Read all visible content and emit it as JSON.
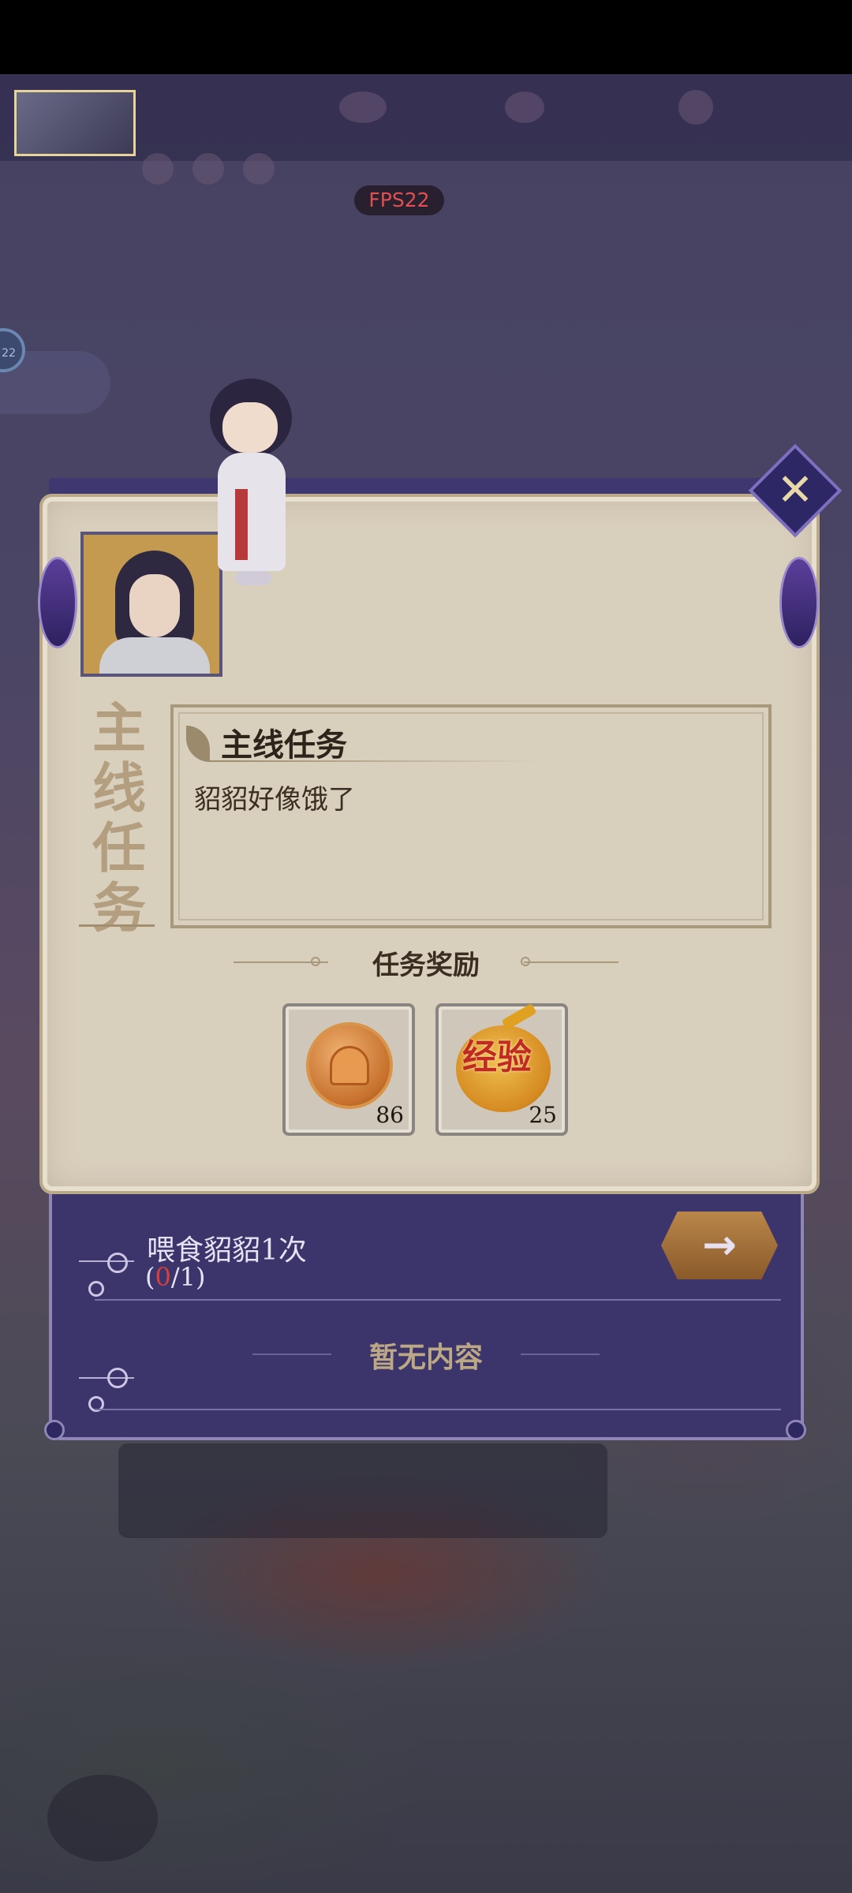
{
  "hud": {
    "fps_label": "FPS22",
    "side_badge": "22"
  },
  "dialog": {
    "vertical_title": [
      "主",
      "线",
      "任",
      "务"
    ],
    "task_title": "主线任务",
    "task_description": "貂貂好像饿了",
    "reward_section_title": "任务奖励",
    "rewards": [
      {
        "icon": "coin-icon",
        "count": "86"
      },
      {
        "icon": "exp-icon",
        "label": "经验",
        "count": "25"
      }
    ],
    "goal": {
      "text": "喂食貂貂1次",
      "progress_open": "(",
      "progress_current": "0",
      "progress_rest": "/1)"
    },
    "empty_text": "暂无内容",
    "go_button_icon": "arrow-right-icon",
    "close_icon": "close-icon"
  },
  "colors": {
    "panel_parchment": "#d9cfbd",
    "panel_purple": "#3b356b",
    "progress_red": "#d24040",
    "fps_red": "#e05050"
  }
}
